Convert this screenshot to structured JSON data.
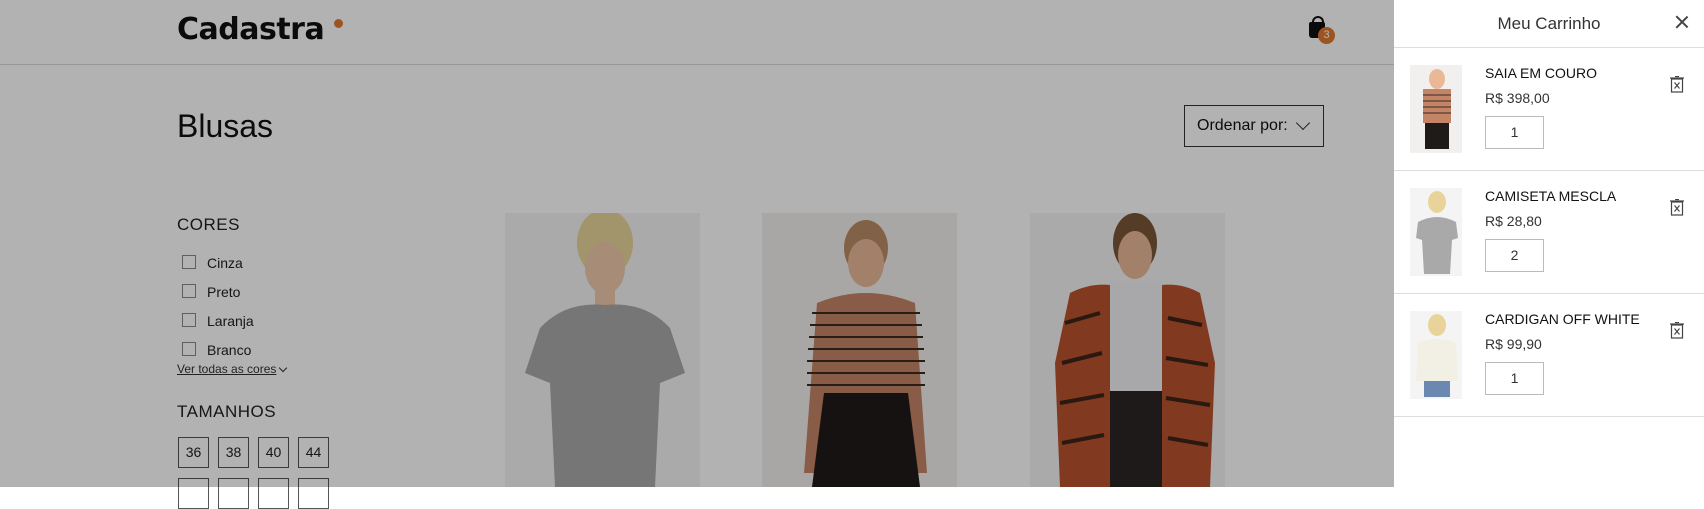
{
  "header": {
    "logo": "Cadastra",
    "cart_count": "3"
  },
  "main": {
    "title": "Blusas",
    "sort_label": "Ordenar por:"
  },
  "filters": {
    "colors_title": "CORES",
    "colors": [
      "Cinza",
      "Preto",
      "Laranja",
      "Branco"
    ],
    "see_all": "Ver todas as cores",
    "sizes_title": "TAMANHOS",
    "sizes": [
      "36",
      "38",
      "40",
      "44"
    ]
  },
  "cart": {
    "title": "Meu Carrinho",
    "items": [
      {
        "name": "SAIA EM COURO",
        "price": "R$ 398,00",
        "qty": "1"
      },
      {
        "name": "CAMISETA MESCLA",
        "price": "R$ 28,80",
        "qty": "2"
      },
      {
        "name": "CARDIGAN OFF WHITE",
        "price": "R$ 99,90",
        "qty": "1"
      }
    ]
  },
  "colors": {
    "accent": "#e07a2f",
    "overlay": "rgba(0,0,0,0.3)"
  },
  "icons": [
    "cart-icon",
    "chevron-down-icon",
    "close-icon",
    "delete-icon",
    "checkbox-icon"
  ]
}
